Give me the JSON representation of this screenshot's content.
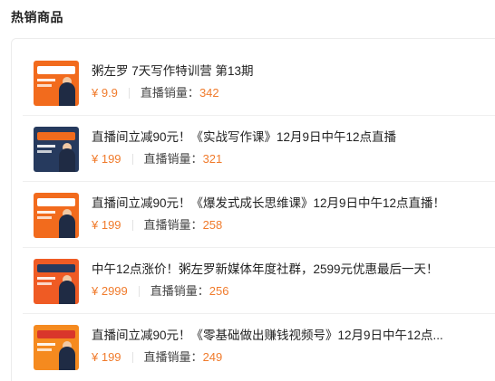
{
  "section_title": "热销商品",
  "products": [
    {
      "title": "粥左罗 7天写作特训营 第13期",
      "price": "¥ 9.9",
      "sales_label": "直播销量：",
      "sales": "342",
      "thumb_bg": "#f26b1d",
      "thumb_band": "#ffffff"
    },
    {
      "title": "直播间立减90元！《实战写作课》12月9日中午12点直播",
      "price": "¥ 199",
      "sales_label": "直播销量：",
      "sales": "321",
      "thumb_bg": "#263a5e",
      "thumb_band": "#f26b1d"
    },
    {
      "title": "直播间立减90元！《爆发式成长思维课》12月9日中午12点直播！",
      "price": "¥ 199",
      "sales_label": "直播销量：",
      "sales": "258",
      "thumb_bg": "#f26b1d",
      "thumb_band": "#ffffff"
    },
    {
      "title": "中午12点涨价！粥左罗新媒体年度社群，2599元优惠最后一天！",
      "price": "¥ 2999",
      "sales_label": "直播销量：",
      "sales": "256",
      "thumb_bg": "#ef5b24",
      "thumb_band": "#263a5e"
    },
    {
      "title": "直播间立减90元！《零基础做出赚钱视频号》12月9日中午12点...",
      "price": "¥ 199",
      "sales_label": "直播销量：",
      "sales": "249",
      "thumb_bg": "#f58a1f",
      "thumb_band": "#d9362b"
    }
  ]
}
